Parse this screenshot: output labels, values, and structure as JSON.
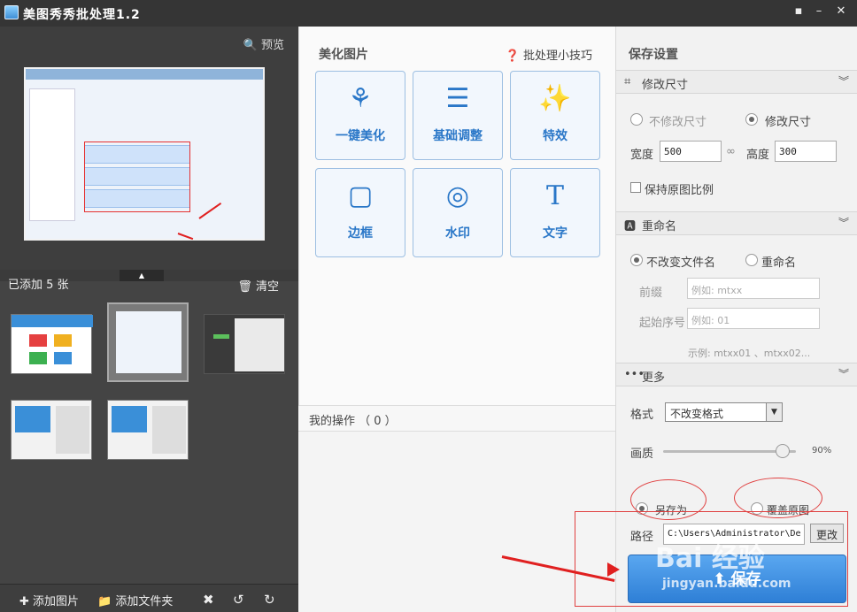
{
  "window": {
    "title": "美图秀秀批处理1.2"
  },
  "left": {
    "preview_label": "预览",
    "added_label": "已添加 5 张",
    "clear_label": "清空",
    "add_image_label": "添加图片",
    "add_folder_label": "添加文件夹"
  },
  "middle": {
    "section_title": "美化图片",
    "tips_label": "批处理小技巧",
    "tiles": [
      {
        "label": "一键美化",
        "icon": "tulip-icon"
      },
      {
        "label": "基础调整",
        "icon": "sliders-icon"
      },
      {
        "label": "特效",
        "icon": "magic-wand-icon"
      },
      {
        "label": "边框",
        "icon": "frame-icon"
      },
      {
        "label": "水印",
        "icon": "watermark-seal-icon"
      },
      {
        "label": "文字",
        "icon": "text-T-icon"
      }
    ],
    "ops_label": "我的操作 （ 0 ）"
  },
  "right": {
    "title": "保存设置",
    "resize": {
      "header": "修改尺寸",
      "opt_no": "不修改尺寸",
      "opt_yes": "修改尺寸",
      "width_label": "宽度",
      "width_value": "500",
      "height_label": "高度",
      "height_value": "300",
      "keep_ratio_label": "保持原图比例"
    },
    "rename": {
      "header": "重命名",
      "opt_keep": "不改变文件名",
      "opt_rename": "重命名",
      "prefix_label": "前缀",
      "prefix_placeholder": "例如: mtxx",
      "start_label": "起始序号",
      "start_placeholder": "例如: 01",
      "example": "示例: mtxx01 、mtxx02..."
    },
    "more": {
      "header": "更多",
      "format_label": "格式",
      "format_value": "不改变格式",
      "quality_label": "画质",
      "quality_value": "90%",
      "quality_fraction": 0.9,
      "opt_save_as": "另存为",
      "opt_overwrite": "覆盖原图",
      "path_label": "路径",
      "path_value": "C:\\Users\\Administrator\\De",
      "change_label": "更改"
    },
    "save_label": "保存"
  },
  "overlays": {
    "watermark_top": "Bai 经验",
    "watermark_bottom": "jingyan.baidu.com",
    "accent": "#e02020"
  }
}
